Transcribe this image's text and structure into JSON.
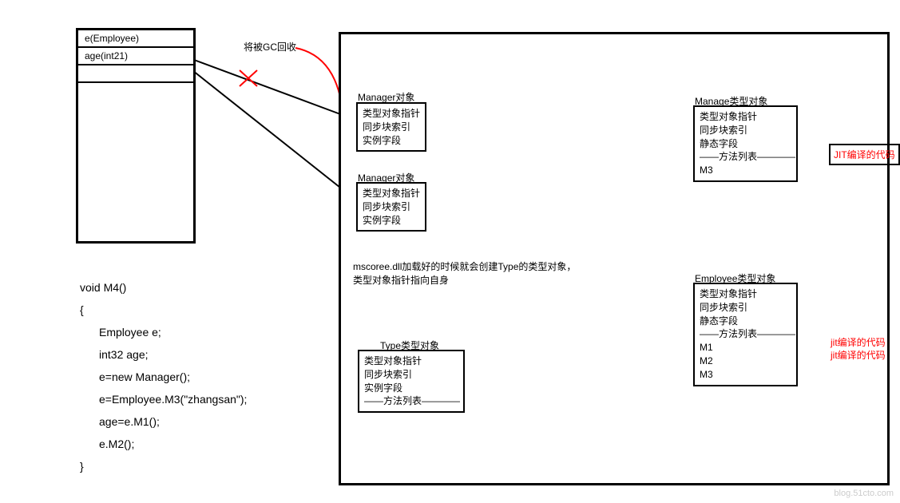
{
  "stack": {
    "cell1": "e(Employee)",
    "cell2": "age(int21)"
  },
  "annotation_gc": "将被GC回收",
  "heap_note_line1": "mscoree.dll加载好的时候就会创建Type的类型对象，",
  "heap_note_line2": "类型对象指针指向自身",
  "obj_mgr1_title": "Manager对象",
  "obj_mgr1_l1": "类型对象指针",
  "obj_mgr1_l2": "同步块索引",
  "obj_mgr1_l3": "实例字段",
  "obj_mgr2_title": "Manager对象",
  "obj_mgr2_l1": "类型对象指针",
  "obj_mgr2_l2": "同步块索引",
  "obj_mgr2_l3": "实例字段",
  "obj_type_title": "Type类型对象",
  "obj_type_l1": "类型对象指针",
  "obj_type_l2": "同步块索引",
  "obj_type_l3": "实例字段",
  "obj_type_l4": "——方法列表————",
  "obj_manage_title": "Manage类型对象",
  "obj_manage_l1": "类型对象指针",
  "obj_manage_l2": "同步块索引",
  "obj_manage_l3": "静态字段",
  "obj_manage_l4": "——方法列表————",
  "obj_manage_l5": "M3",
  "obj_emp_title": "Employee类型对象",
  "obj_emp_l1": "类型对象指针",
  "obj_emp_l2": "同步块索引",
  "obj_emp_l3": "静态字段",
  "obj_emp_l4": "——方法列表————",
  "obj_emp_l5": "M1",
  "obj_emp_l6": "M2",
  "obj_emp_l7": "M3",
  "jit_box": "JIT编译的代码",
  "jit_label1": "jit编译的代码",
  "jit_label2": "jit编译的代码",
  "code_l1": "void M4()",
  "code_l2": "{",
  "code_l3": "Employee e;",
  "code_l4": "int32 age;",
  "code_l5": "e=new Manager();",
  "code_l6": "e=Employee.M3(\"zhangsan\");",
  "code_l7": "age=e.M1();",
  "code_l8": "e.M2();",
  "code_l9": "}",
  "watermark": "blog.51cto.com"
}
